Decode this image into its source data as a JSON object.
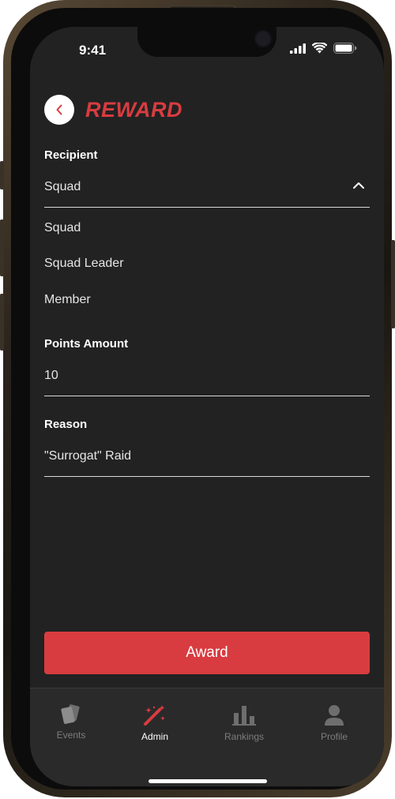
{
  "status_bar": {
    "time": "9:41"
  },
  "header": {
    "title": "REWARD"
  },
  "recipient": {
    "label": "Recipient",
    "value": "Squad",
    "options": [
      "Squad",
      "Squad Leader",
      "Member"
    ]
  },
  "points": {
    "label": "Points Amount",
    "value": "10"
  },
  "reason": {
    "label": "Reason",
    "value": "\"Surrogat\" Raid"
  },
  "award_button": {
    "label": "Award"
  },
  "tabs": [
    {
      "label": "Events",
      "icon": "cards-icon",
      "active": false
    },
    {
      "label": "Admin",
      "icon": "magic-wand-icon",
      "active": true
    },
    {
      "label": "Rankings",
      "icon": "bar-chart-icon",
      "active": false
    },
    {
      "label": "Profile",
      "icon": "user-icon",
      "active": false
    }
  ],
  "colors": {
    "accent": "#d83c40",
    "background": "#222222",
    "tab_inactive": "#7d7d7d"
  }
}
